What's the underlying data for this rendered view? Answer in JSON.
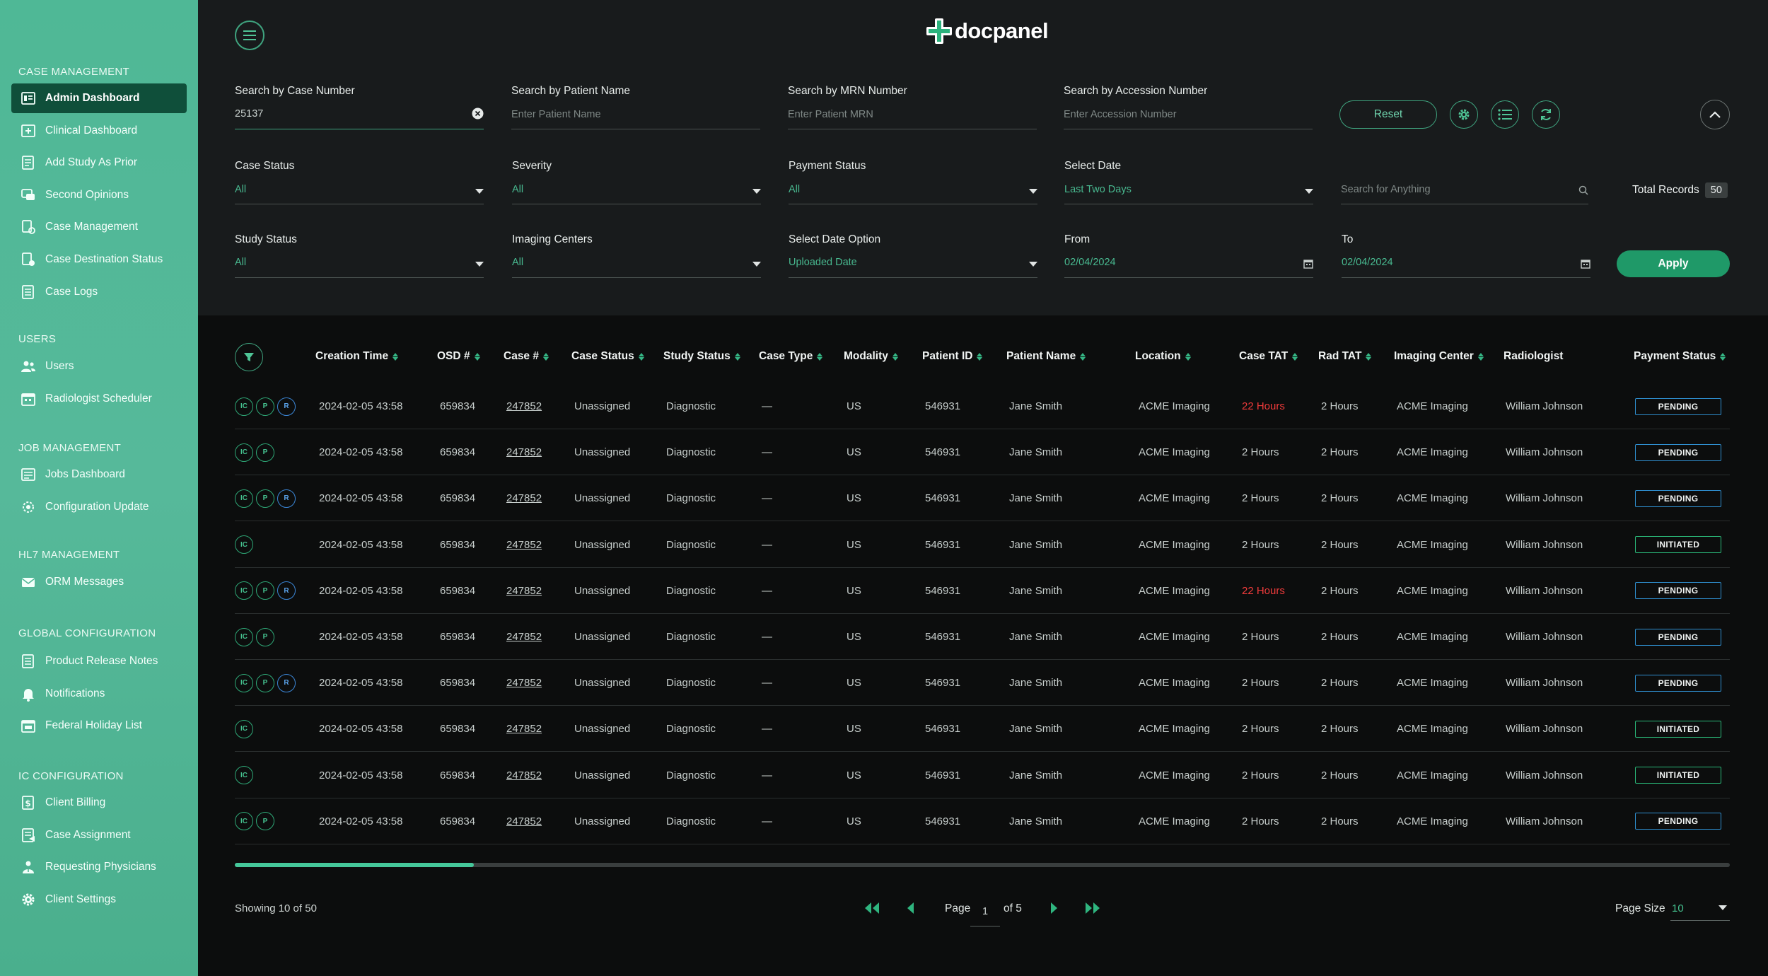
{
  "sidebar": {
    "sections": [
      {
        "title": "CASE MANAGEMENT",
        "items": [
          {
            "label": "Admin Dashboard",
            "icon": "dashboard-icon",
            "active": true
          },
          {
            "label": "Clinical Dashboard",
            "icon": "clinical-icon"
          },
          {
            "label": "Add Study As Prior",
            "icon": "document-icon"
          },
          {
            "label": "Second Opinions",
            "icon": "chat-icon"
          },
          {
            "label": "Case Management",
            "icon": "case-icon"
          },
          {
            "label": "Case Destination Status",
            "icon": "destination-icon"
          },
          {
            "label": "Case Logs",
            "icon": "logs-icon"
          }
        ]
      },
      {
        "title": "USERS",
        "items": [
          {
            "label": "Users",
            "icon": "users-icon"
          },
          {
            "label": "Radiologist Scheduler",
            "icon": "calendar-icon"
          }
        ]
      },
      {
        "title": "JOB MANAGEMENT",
        "items": [
          {
            "label": "Jobs Dashboard",
            "icon": "jobs-icon"
          },
          {
            "label": "Configuration Update",
            "icon": "config-icon"
          }
        ]
      },
      {
        "title": "HL7 MANAGEMENT",
        "items": [
          {
            "label": "ORM Messages",
            "icon": "mail-icon"
          }
        ]
      },
      {
        "title": "GLOBAL CONFIGURATION",
        "items": [
          {
            "label": "Product Release Notes",
            "icon": "notes-icon"
          },
          {
            "label": "Notifications",
            "icon": "bell-icon"
          },
          {
            "label": "Federal Holiday List",
            "icon": "holiday-icon"
          }
        ]
      },
      {
        "title": "IC CONFIGURATION",
        "items": [
          {
            "label": "Client Billing",
            "icon": "billing-icon"
          },
          {
            "label": "Case Assignment",
            "icon": "assignment-icon"
          },
          {
            "label": "Requesting Physicians",
            "icon": "physician-icon"
          },
          {
            "label": "Client Settings",
            "icon": "settings-icon"
          }
        ]
      }
    ]
  },
  "header": {
    "logo_text": "docpanel"
  },
  "search": {
    "case_number": {
      "label": "Search by Case Number",
      "value": "25137"
    },
    "patient_name": {
      "label": "Search by Patient Name",
      "placeholder": "Enter Patient Name"
    },
    "mrn": {
      "label": "Search by MRN Number",
      "placeholder": "Enter Patient MRN"
    },
    "accession": {
      "label": "Search by Accession Number",
      "placeholder": "Enter Accession Number"
    },
    "reset_label": "Reset",
    "anything_placeholder": "Search for Anything"
  },
  "filters": {
    "case_status": {
      "label": "Case Status",
      "value": "All"
    },
    "severity": {
      "label": "Severity",
      "value": "All"
    },
    "payment_status": {
      "label": "Payment Status",
      "value": "All"
    },
    "select_date": {
      "label": "Select Date",
      "value": "Last Two Days"
    },
    "study_status": {
      "label": "Study Status",
      "value": "All"
    },
    "imaging_centers": {
      "label": "Imaging Centers",
      "value": "All"
    },
    "date_option": {
      "label": "Select Date Option",
      "value": "Uploaded Date"
    },
    "from": {
      "label": "From",
      "value": "02/04/2024"
    },
    "to": {
      "label": "To",
      "value": "02/04/2024"
    },
    "apply_label": "Apply"
  },
  "total_records": {
    "label": "Total Records",
    "count": "50"
  },
  "table": {
    "columns": [
      "Creation Time",
      "OSD #",
      "Case #",
      "Case Status",
      "Study Status",
      "Case Type",
      "Modality",
      "Patient ID",
      "Patient Name",
      "Location",
      "Case TAT",
      "Rad TAT",
      "Imaging Center",
      "Radiologist",
      "Payment Status"
    ],
    "rows": [
      {
        "badges": [
          "IC",
          "P",
          "R"
        ],
        "creation": "2024-02-05 43:58",
        "osd": "659834",
        "case": "247852",
        "case_status": "Unassigned",
        "study_status": "Diagnostic",
        "case_type": "—",
        "modality": "US",
        "patient_id": "546931",
        "patient_name": "Jane Smith",
        "location": "ACME Imaging",
        "case_tat": "22 Hours",
        "case_tat_alert": true,
        "rad_tat": "2 Hours",
        "imaging_center": "ACME Imaging",
        "radiologist": "William Johnson",
        "payment": "PENDING"
      },
      {
        "badges": [
          "IC",
          "P"
        ],
        "creation": "2024-02-05 43:58",
        "osd": "659834",
        "case": "247852",
        "case_status": "Unassigned",
        "study_status": "Diagnostic",
        "case_type": "—",
        "modality": "US",
        "patient_id": "546931",
        "patient_name": "Jane Smith",
        "location": "ACME Imaging",
        "case_tat": "2 Hours",
        "case_tat_alert": false,
        "rad_tat": "2 Hours",
        "imaging_center": "ACME Imaging",
        "radiologist": "William Johnson",
        "payment": "PENDING"
      },
      {
        "badges": [
          "IC",
          "P",
          "R"
        ],
        "creation": "2024-02-05 43:58",
        "osd": "659834",
        "case": "247852",
        "case_status": "Unassigned",
        "study_status": "Diagnostic",
        "case_type": "—",
        "modality": "US",
        "patient_id": "546931",
        "patient_name": "Jane Smith",
        "location": "ACME Imaging",
        "case_tat": "2 Hours",
        "case_tat_alert": false,
        "rad_tat": "2 Hours",
        "imaging_center": "ACME Imaging",
        "radiologist": "William Johnson",
        "payment": "PENDING"
      },
      {
        "badges": [
          "IC"
        ],
        "creation": "2024-02-05 43:58",
        "osd": "659834",
        "case": "247852",
        "case_status": "Unassigned",
        "study_status": "Diagnostic",
        "case_type": "—",
        "modality": "US",
        "patient_id": "546931",
        "patient_name": "Jane Smith",
        "location": "ACME Imaging",
        "case_tat": "2 Hours",
        "case_tat_alert": false,
        "rad_tat": "2 Hours",
        "imaging_center": "ACME Imaging",
        "radiologist": "William Johnson",
        "payment": "INITIATED"
      },
      {
        "badges": [
          "IC",
          "P",
          "R"
        ],
        "creation": "2024-02-05 43:58",
        "osd": "659834",
        "case": "247852",
        "case_status": "Unassigned",
        "study_status": "Diagnostic",
        "case_type": "—",
        "modality": "US",
        "patient_id": "546931",
        "patient_name": "Jane Smith",
        "location": "ACME Imaging",
        "case_tat": "22 Hours",
        "case_tat_alert": true,
        "rad_tat": "2 Hours",
        "imaging_center": "ACME Imaging",
        "radiologist": "William Johnson",
        "payment": "PENDING"
      },
      {
        "badges": [
          "IC",
          "P"
        ],
        "creation": "2024-02-05 43:58",
        "osd": "659834",
        "case": "247852",
        "case_status": "Unassigned",
        "study_status": "Diagnostic",
        "case_type": "—",
        "modality": "US",
        "patient_id": "546931",
        "patient_name": "Jane Smith",
        "location": "ACME Imaging",
        "case_tat": "2 Hours",
        "case_tat_alert": false,
        "rad_tat": "2 Hours",
        "imaging_center": "ACME Imaging",
        "radiologist": "William Johnson",
        "payment": "PENDING"
      },
      {
        "badges": [
          "IC",
          "P",
          "R"
        ],
        "creation": "2024-02-05 43:58",
        "osd": "659834",
        "case": "247852",
        "case_status": "Unassigned",
        "study_status": "Diagnostic",
        "case_type": "—",
        "modality": "US",
        "patient_id": "546931",
        "patient_name": "Jane Smith",
        "location": "ACME Imaging",
        "case_tat": "2 Hours",
        "case_tat_alert": false,
        "rad_tat": "2 Hours",
        "imaging_center": "ACME Imaging",
        "radiologist": "William Johnson",
        "payment": "PENDING"
      },
      {
        "badges": [
          "IC"
        ],
        "creation": "2024-02-05 43:58",
        "osd": "659834",
        "case": "247852",
        "case_status": "Unassigned",
        "study_status": "Diagnostic",
        "case_type": "—",
        "modality": "US",
        "patient_id": "546931",
        "patient_name": "Jane Smith",
        "location": "ACME Imaging",
        "case_tat": "2 Hours",
        "case_tat_alert": false,
        "rad_tat": "2 Hours",
        "imaging_center": "ACME Imaging",
        "radiologist": "William Johnson",
        "payment": "INITIATED"
      },
      {
        "badges": [
          "IC"
        ],
        "creation": "2024-02-05 43:58",
        "osd": "659834",
        "case": "247852",
        "case_status": "Unassigned",
        "study_status": "Diagnostic",
        "case_type": "—",
        "modality": "US",
        "patient_id": "546931",
        "patient_name": "Jane Smith",
        "location": "ACME Imaging",
        "case_tat": "2 Hours",
        "case_tat_alert": false,
        "rad_tat": "2 Hours",
        "imaging_center": "ACME Imaging",
        "radiologist": "William Johnson",
        "payment": "INITIATED"
      },
      {
        "badges": [
          "IC",
          "P"
        ],
        "creation": "2024-02-05 43:58",
        "osd": "659834",
        "case": "247852",
        "case_status": "Unassigned",
        "study_status": "Diagnostic",
        "case_type": "—",
        "modality": "US",
        "patient_id": "546931",
        "patient_name": "Jane Smith",
        "location": "ACME Imaging",
        "case_tat": "2 Hours",
        "case_tat_alert": false,
        "rad_tat": "2 Hours",
        "imaging_center": "ACME Imaging",
        "radiologist": "William Johnson",
        "payment": "PENDING"
      }
    ]
  },
  "pagination": {
    "showing": "Showing 10 of 50",
    "page_label": "Page",
    "current_page": "1",
    "of_label": "of 5",
    "page_size_label": "Page Size",
    "page_size": "10"
  },
  "colors": {
    "sidebar_bg": "#4fb896",
    "active_item": "#0f4f3a",
    "accent": "#3fa47f",
    "apply_button": "#1f9968",
    "alert_red": "#ef3b3b",
    "pending_border": "#2f8fd0",
    "initiated_border": "#2ab878"
  }
}
